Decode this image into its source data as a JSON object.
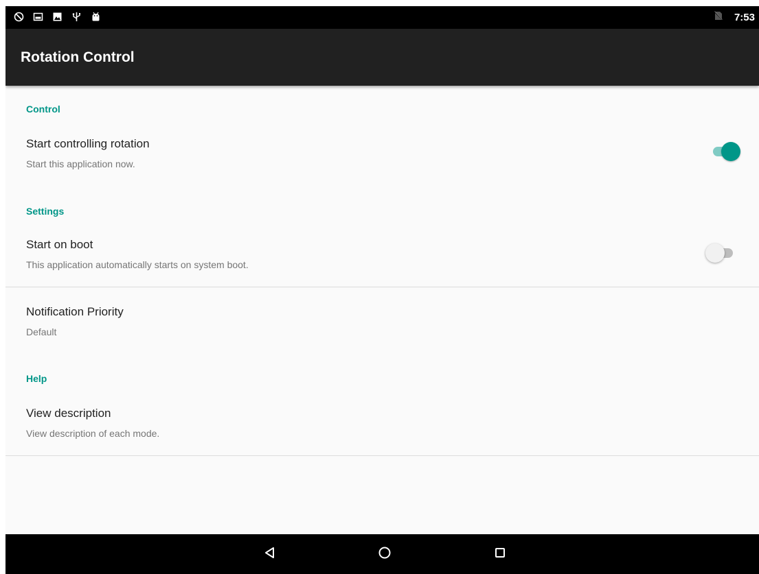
{
  "status_bar": {
    "left_icons": [
      "rotation-off-icon",
      "image-icon",
      "photo-icon",
      "usb-icon",
      "android-icon"
    ],
    "right_icons": [
      "no-sim-icon"
    ],
    "time": "7:53"
  },
  "app_bar": {
    "title": "Rotation Control"
  },
  "sections": {
    "control": {
      "header": "Control",
      "start_controlling": {
        "title": "Start controlling rotation",
        "summary": "Start this application now.",
        "enabled": true
      }
    },
    "settings": {
      "header": "Settings",
      "start_on_boot": {
        "title": "Start on boot",
        "summary": "This application automatically starts on system boot.",
        "enabled": false
      },
      "notification_priority": {
        "title": "Notification Priority",
        "summary": "Default"
      }
    },
    "help": {
      "header": "Help",
      "view_description": {
        "title": "View description",
        "summary": "View description of each mode."
      }
    }
  },
  "nav_bar": {
    "buttons": [
      "back-icon",
      "home-icon",
      "recents-icon"
    ]
  },
  "colors": {
    "accent": "#009688",
    "accent_light": "#80cbc4",
    "app_bar": "#212121",
    "background": "#fafafa"
  }
}
